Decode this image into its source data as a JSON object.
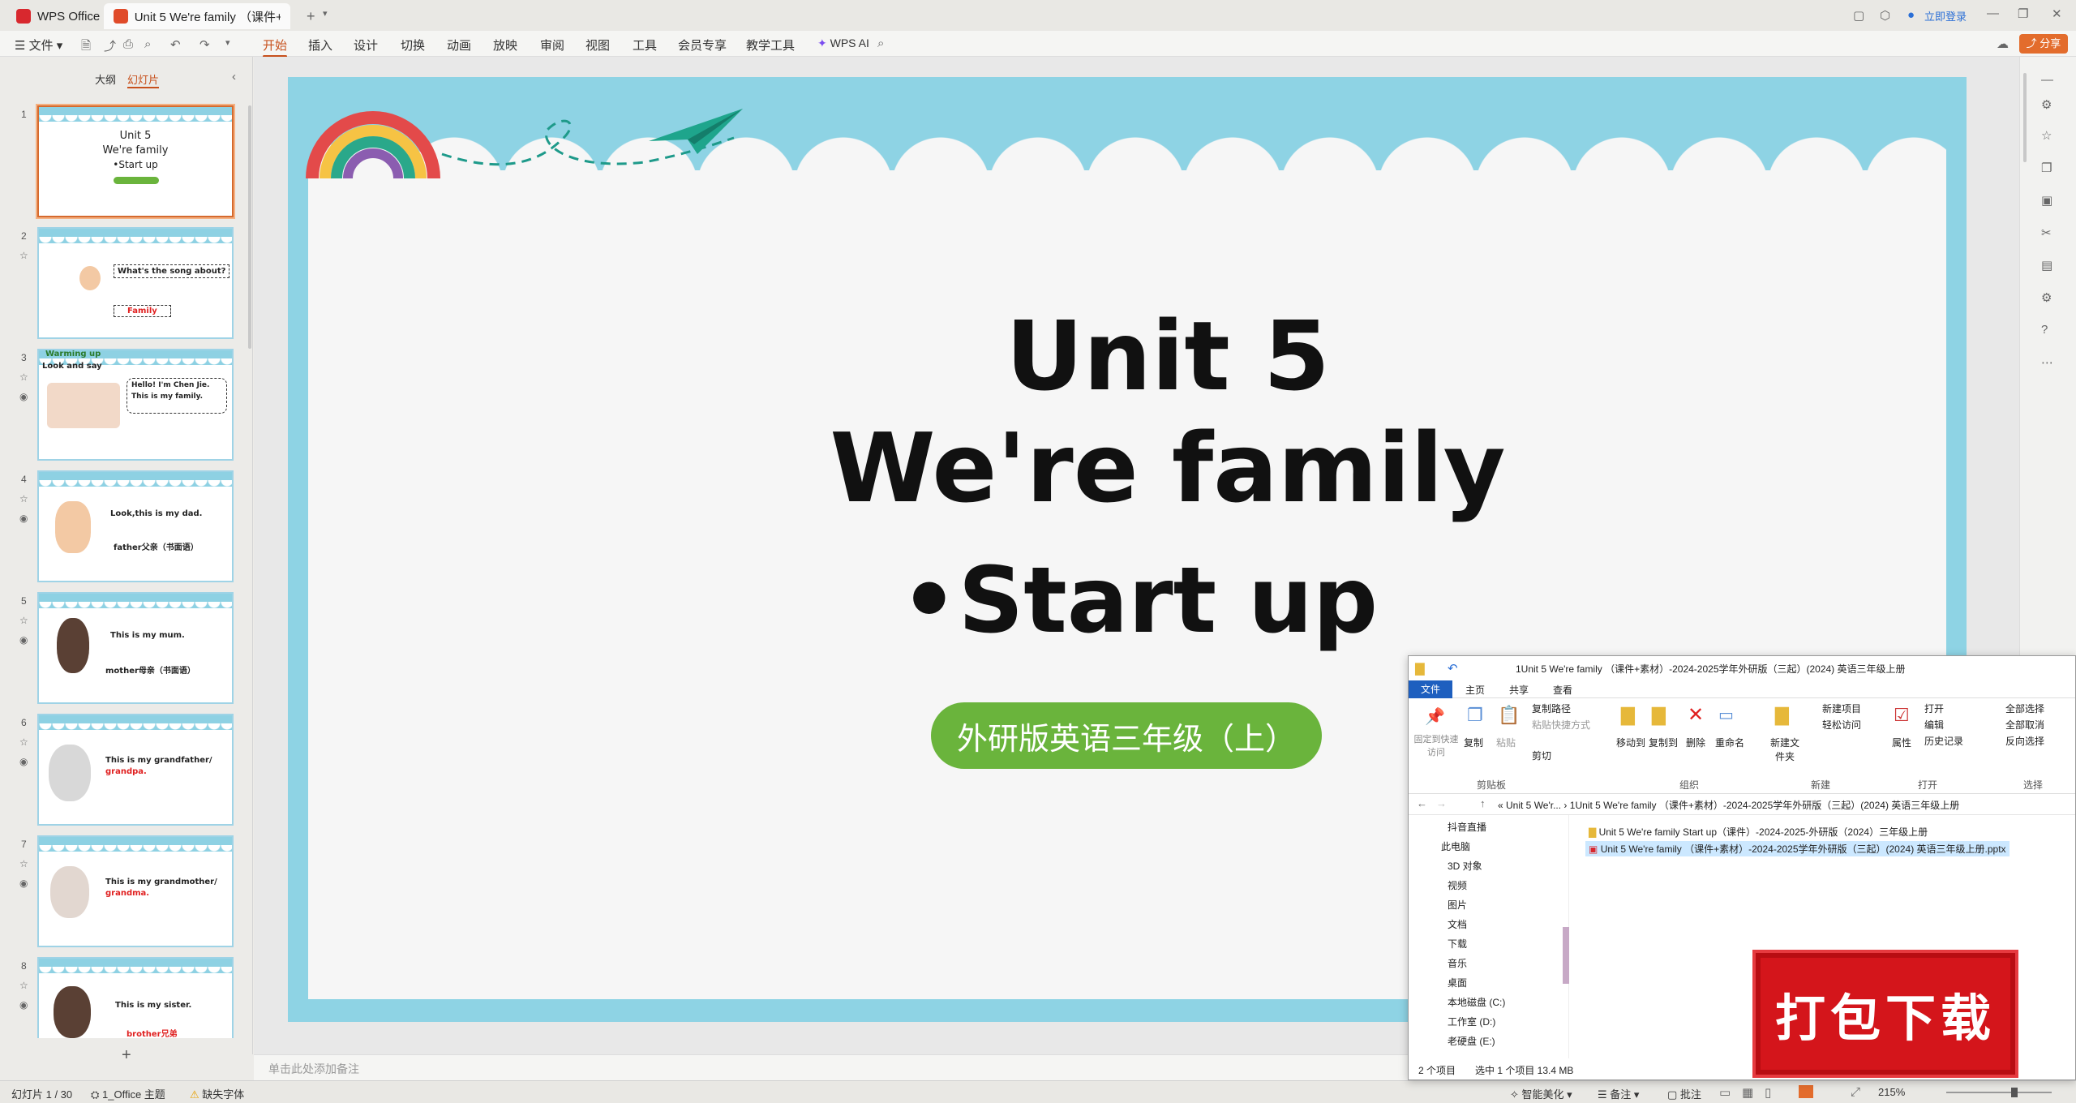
{
  "titlebar": {
    "app_tab": "WPS Office",
    "doc_tab": "Unit 5 We're family （课件+",
    "login": "立即登录"
  },
  "menubar": {
    "file": "文件",
    "items": [
      "开始",
      "插入",
      "设计",
      "切换",
      "动画",
      "放映",
      "审阅",
      "视图",
      "工具",
      "会员专享",
      "教学工具"
    ],
    "wps_ai": "WPS AI",
    "share": "分享"
  },
  "thumbpane": {
    "tab_outline": "大纲",
    "tab_slides": "幻灯片",
    "add_label": "+",
    "slides": [
      {
        "num": "1",
        "lines": [
          "Unit 5",
          "We're family",
          "•Start up"
        ]
      },
      {
        "num": "2",
        "lines": [
          "What's the song about?",
          "Family"
        ]
      },
      {
        "num": "3",
        "lines": [
          "Warming up",
          "Look and say",
          "Hello!  I'm Chen Jie.",
          "This is my family."
        ]
      },
      {
        "num": "4",
        "lines": [
          "Look,this is my dad.",
          "father父亲（书面语）"
        ]
      },
      {
        "num": "5",
        "lines": [
          "This is my mum.",
          "mother母亲（书面语）"
        ]
      },
      {
        "num": "6",
        "lines": [
          "This is my grandfather/",
          "grandpa."
        ]
      },
      {
        "num": "7",
        "lines": [
          "This is my grandmother/",
          "grandma."
        ]
      },
      {
        "num": "8",
        "lines": [
          "This is my sister.",
          "brother兄弟"
        ]
      }
    ]
  },
  "slide": {
    "title1": "Unit 5",
    "title2": "We're family",
    "bullet": "•Start up",
    "pill": "外研版英语三年级（上）"
  },
  "notes": {
    "placeholder": "单击此处添加备注"
  },
  "status": {
    "slide_count": "幻灯片 1 / 30",
    "theme": "1_Office 主题",
    "missing_font": "缺失字体",
    "smart_beautify": "智能美化",
    "notes": "备注",
    "comments": "批注",
    "zoom": "215%"
  },
  "explorer": {
    "title": "1Unit 5 We're family （课件+素材）-2024-2025学年外研版（三起）(2024) 英语三年级上册",
    "tabs": [
      "文件",
      "主页",
      "共享",
      "查看"
    ],
    "ribbon": {
      "pin": "固定到快速访问",
      "copy": "复制",
      "paste": "粘贴",
      "copy_path": "复制路径",
      "paste_shortcut": "粘贴快捷方式",
      "cut": "剪切",
      "move_to": "移动到",
      "copy_to": "复制到",
      "delete": "删除",
      "rename": "重命名",
      "new_folder": "新建文件夹",
      "new_item": "新建项目",
      "easy_access": "轻松访问",
      "properties": "属性",
      "open": "打开",
      "edit": "编辑",
      "history": "历史记录",
      "select_all": "全部选择",
      "select_none": "全部取消",
      "invert": "反向选择",
      "groups": [
        "剪贴板",
        "组织",
        "新建",
        "打开",
        "选择"
      ]
    },
    "address": "« Unit 5 We'r... › 1Unit 5 We're family （课件+素材）-2024-2025学年外研版（三起）(2024) 英语三年级上册",
    "nav": [
      "抖音直播",
      "此电脑",
      "3D 对象",
      "视频",
      "图片",
      "文档",
      "下载",
      "音乐",
      "桌面",
      "本地磁盘 (C:)",
      "工作室 (D:)",
      "老硬盘 (E:)"
    ],
    "files": [
      "Unit 5 We're family Start up（课件）-2024-2025-外研版（2024）三年级上册",
      "Unit 5 We're family （课件+素材）-2024-2025学年外研版（三起）(2024) 英语三年级上册.pptx"
    ],
    "status_items": "2 个项目",
    "status_selected": "选中 1 个项目  13.4 MB"
  },
  "stamp": {
    "text": "打包下载"
  },
  "colors": {
    "accent": "#c7501c",
    "slide_bg": "#8ed3e4",
    "pill": "#6ab43c",
    "stamp": "#d4151b"
  }
}
